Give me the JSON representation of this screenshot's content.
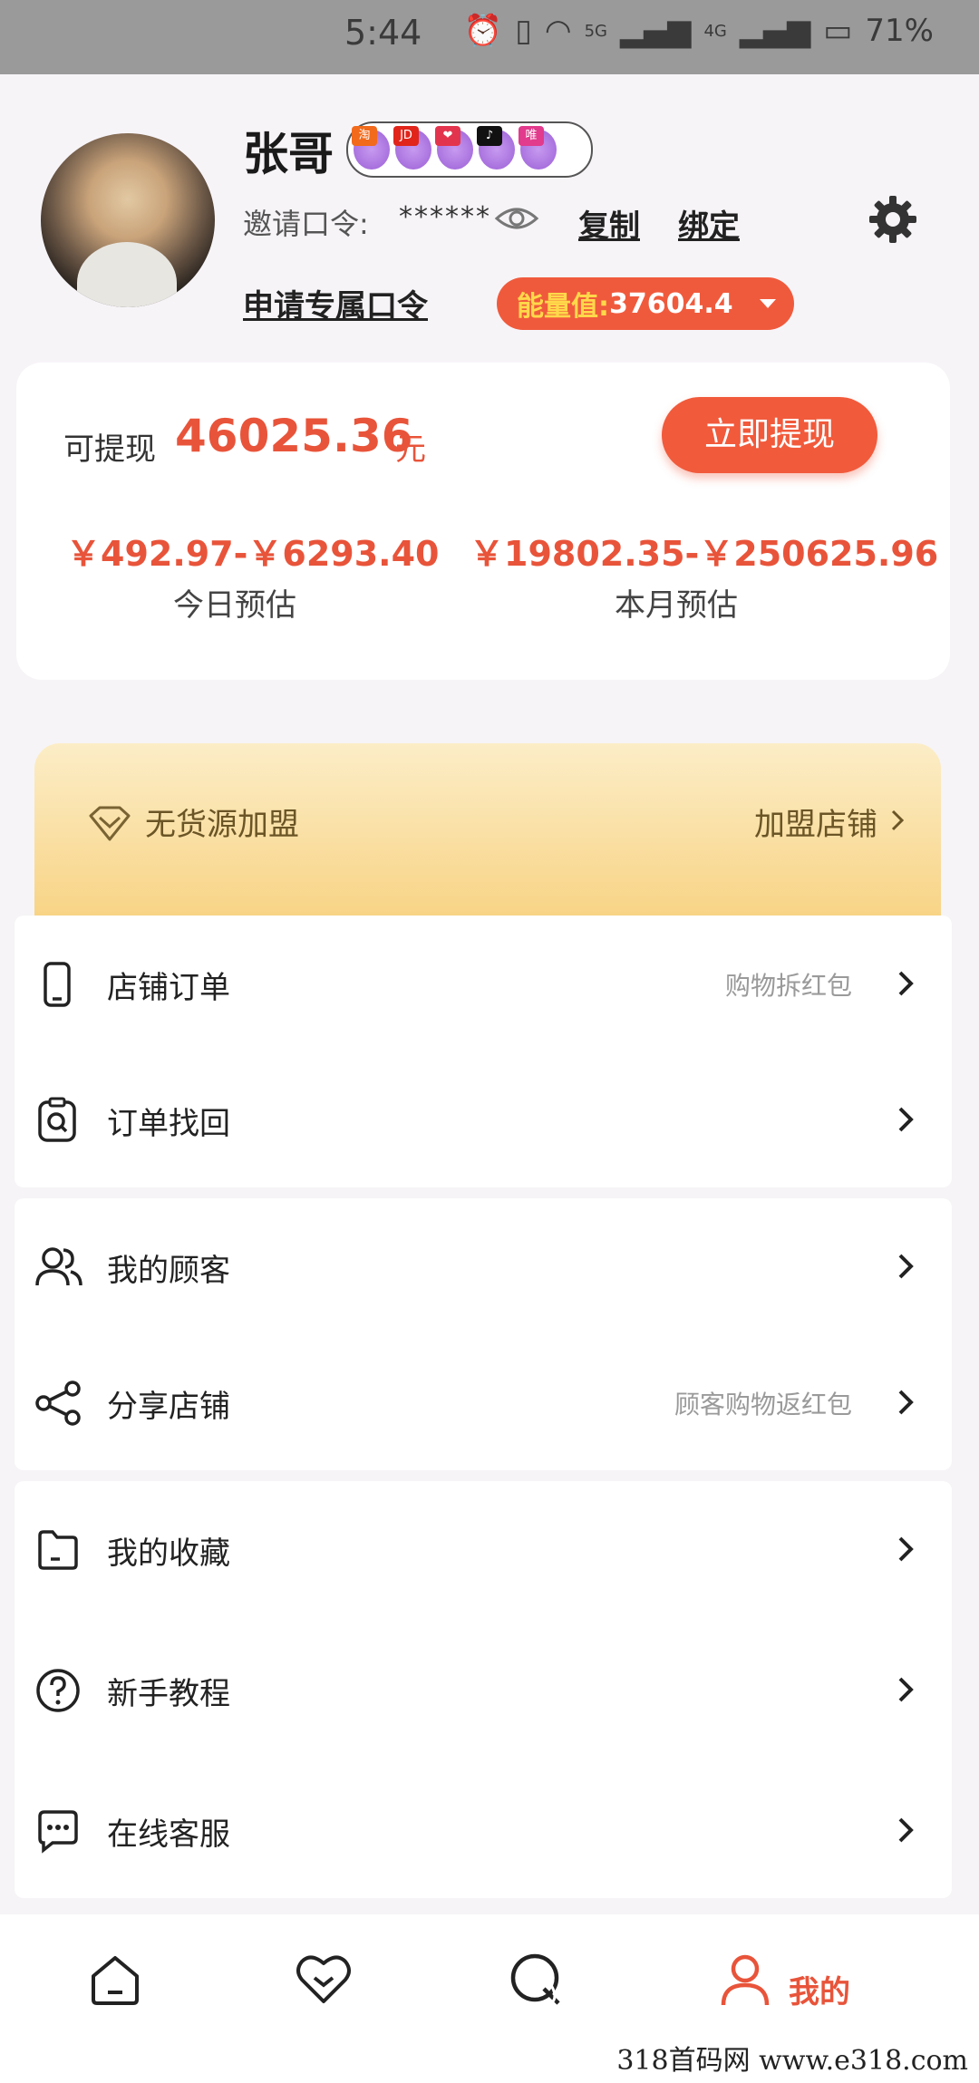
{
  "status_bar": {
    "time": "5:44",
    "net1": "5G",
    "net2": "4G",
    "battery": "71%"
  },
  "profile": {
    "name": "张哥",
    "badges": [
      "淘",
      "JD",
      "❤",
      "♪",
      "唯"
    ],
    "invite_label": "邀请口令:",
    "invite_code_masked": "******",
    "copy_label": "复制",
    "bind_label": "绑定",
    "apply_label": "申请专属口令",
    "energy_label": "能量值:",
    "energy_value": "37604.4"
  },
  "wallet": {
    "withdrawable_label": "可提现",
    "withdrawable_value": "46025.36",
    "unit": "元",
    "withdraw_button": "立即提现",
    "today_range": "￥492.97-￥6293.40",
    "today_label": "今日预估",
    "month_range": "￥19802.35-￥250625.96",
    "month_label": "本月预估"
  },
  "banner": {
    "title": "无货源加盟",
    "action": "加盟店铺"
  },
  "menu": {
    "store_orders": {
      "label": "店铺订单",
      "hint": "购物拆红包"
    },
    "order_recovery": {
      "label": "订单找回"
    },
    "my_customers": {
      "label": "我的顾客"
    },
    "share_store": {
      "label": "分享店铺",
      "hint": "顾客购物返红包"
    },
    "favorites": {
      "label": "我的收藏"
    },
    "tutorial": {
      "label": "新手教程"
    },
    "support": {
      "label": "在线客服"
    }
  },
  "tabbar": {
    "mine_label": "我的"
  },
  "watermark": "318首码网  www.e318.com",
  "colors": {
    "accent": "#f15a3b",
    "accent_text": "#e8543a",
    "banner_gold": "#f8d486"
  }
}
